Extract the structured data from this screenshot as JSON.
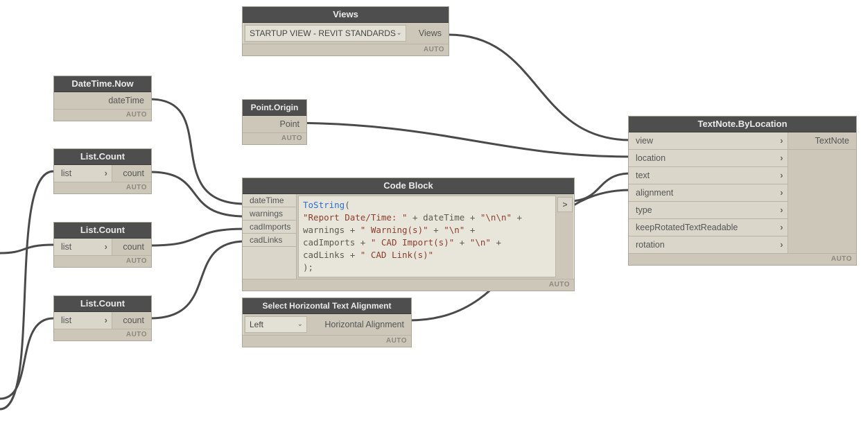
{
  "misc": {
    "auto": "AUTO"
  },
  "datetime_now": {
    "title": "DateTime.Now",
    "out": "dateTime"
  },
  "list_count": {
    "title": "List.Count",
    "in": "list",
    "out": "count"
  },
  "views": {
    "title": "Views",
    "selected": "STARTUP VIEW - REVIT STANDARDS",
    "out": "Views"
  },
  "point_origin": {
    "title": "Point.Origin",
    "out": "Point"
  },
  "code_block": {
    "title": "Code Block",
    "inputs": [
      "dateTime",
      "warnings",
      "cadImports",
      "cadLinks"
    ],
    "code": {
      "fn": "ToString",
      "l1a": "\"Report Date/Time: \"",
      "l1b": " + dateTime + ",
      "l1c": "\"\\n\\n\"",
      "l1d": " +",
      "l2a": "warnings + ",
      "l2b": "\" Warning(s)\"",
      "l2c": " + ",
      "l2d": "\"\\n\"",
      "l2e": " +",
      "l3a": "cadImports + ",
      "l3b": "\" CAD Import(s)\"",
      "l3c": " + ",
      "l3d": "\"\\n\"",
      "l3e": " +",
      "l4a": "cadLinks + ",
      "l4b": "\" CAD Link(s)\"",
      "l5": ");"
    },
    "out": ">"
  },
  "halign": {
    "title": "Select Horizontal Text Alignment",
    "selected": "Left",
    "out": "Horizontal Alignment"
  },
  "textnote": {
    "title": "TextNote.ByLocation",
    "inputs": [
      "view",
      "location",
      "text",
      "alignment",
      "type",
      "keepRotatedTextReadable",
      "rotation"
    ],
    "out": "TextNote"
  }
}
